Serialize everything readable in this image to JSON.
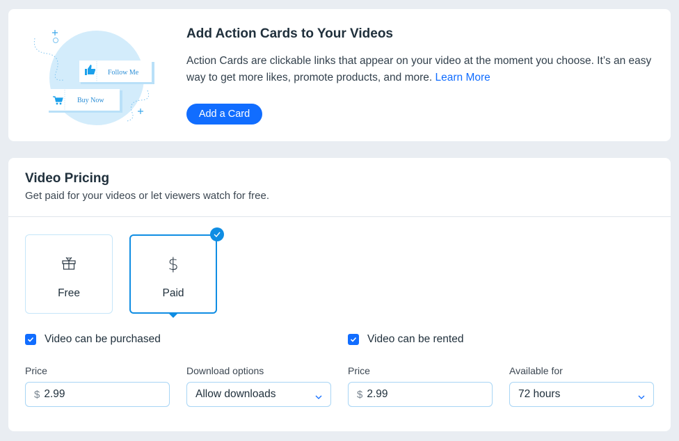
{
  "action_cards": {
    "title": "Add Action Cards to Your Videos",
    "description": "Action Cards are clickable links that appear on your video at the moment you choose. It’s an easy way to get more likes, promote products, and more.",
    "learn_more_label": "Learn More",
    "add_button_label": "Add a Card",
    "illustration": {
      "follow_label": "Follow Me",
      "buy_label": "Buy Now"
    }
  },
  "pricing": {
    "title": "Video Pricing",
    "subtitle": "Get paid for your videos or let viewers watch for free.",
    "options": [
      {
        "label": "Free",
        "icon": "gift-icon",
        "selected": false
      },
      {
        "label": "Paid",
        "icon": "dollar-icon",
        "selected": true
      }
    ],
    "purchase": {
      "checkbox_label": "Video can be purchased",
      "checked": true,
      "price_label": "Price",
      "currency_symbol": "$",
      "price_value": "2.99",
      "download_label": "Download options",
      "download_value": "Allow downloads"
    },
    "rent": {
      "checkbox_label": "Video can be rented",
      "checked": true,
      "price_label": "Price",
      "currency_symbol": "$",
      "price_value": "2.99",
      "available_label": "Available for",
      "available_value": "72 hours"
    }
  },
  "colors": {
    "accent": "#116dff",
    "selected_border": "#0f8de3",
    "background": "#e9edf2"
  }
}
